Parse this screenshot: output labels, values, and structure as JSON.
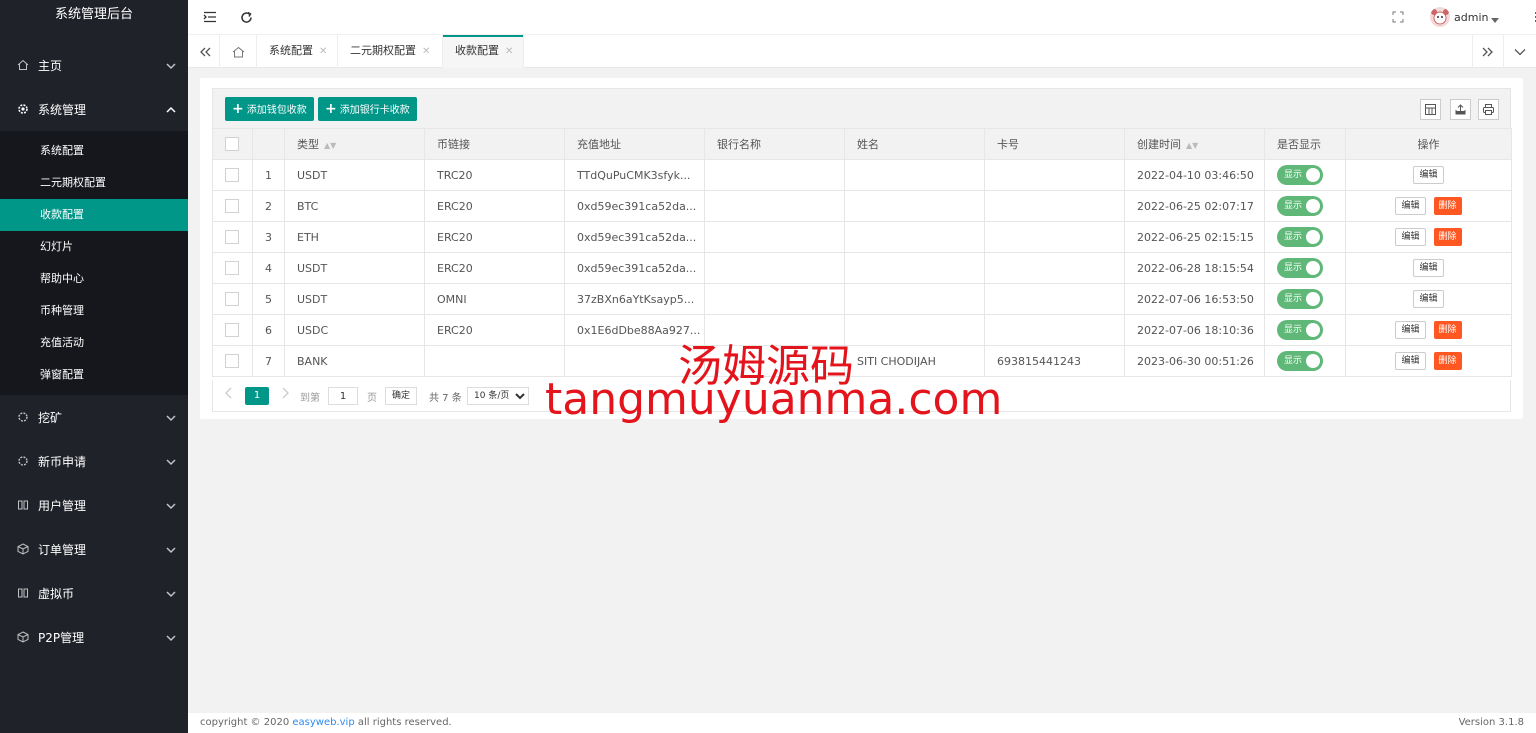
{
  "app": {
    "title": "系统管理后台"
  },
  "sidebar": {
    "home": {
      "label": "主页"
    },
    "system": {
      "label": "系统管理"
    },
    "sub_items": [
      "系统配置",
      "二元期权配置",
      "收款配置",
      "幻灯片",
      "帮助中心",
      "币种管理",
      "充值活动",
      "弹窗配置"
    ],
    "active_sub": "收款配置",
    "groups": [
      "挖矿",
      "新币申请",
      "用户管理",
      "订单管理",
      "虚拟币",
      "P2P管理"
    ]
  },
  "header": {
    "user": "admin"
  },
  "tabs": [
    {
      "label": "系统配置"
    },
    {
      "label": "二元期权配置"
    },
    {
      "label": "收款配置",
      "active": true
    }
  ],
  "toolbar": {
    "add_wallet": "添加钱包收款",
    "add_bank": "添加银行卡收款"
  },
  "table": {
    "headers": [
      "",
      "",
      "类型",
      "币链接",
      "充值地址",
      "银行名称",
      "姓名",
      "卡号",
      "创建时间",
      "是否显示",
      "操作"
    ],
    "rows": [
      {
        "no": "1",
        "type": "USDT",
        "chain": "TRC20",
        "address": "TTdQuPuCMK3sfyk...",
        "bank": "",
        "name": "",
        "card": "",
        "created": "2022-04-10 03:46:50",
        "show": "显示",
        "deletable": false
      },
      {
        "no": "2",
        "type": "BTC",
        "chain": "ERC20",
        "address": "0xd59ec391ca52da...",
        "bank": "",
        "name": "",
        "card": "",
        "created": "2022-06-25 02:07:17",
        "show": "显示",
        "deletable": true
      },
      {
        "no": "3",
        "type": "ETH",
        "chain": "ERC20",
        "address": "0xd59ec391ca52da...",
        "bank": "",
        "name": "",
        "card": "",
        "created": "2022-06-25 02:15:15",
        "show": "显示",
        "deletable": true
      },
      {
        "no": "4",
        "type": "USDT",
        "chain": "ERC20",
        "address": "0xd59ec391ca52da...",
        "bank": "",
        "name": "",
        "card": "",
        "created": "2022-06-28 18:15:54",
        "show": "显示",
        "deletable": false
      },
      {
        "no": "5",
        "type": "USDT",
        "chain": "OMNI",
        "address": "37zBXn6aYtKsayp5...",
        "bank": "",
        "name": "",
        "card": "",
        "created": "2022-07-06 16:53:50",
        "show": "显示",
        "deletable": false
      },
      {
        "no": "6",
        "type": "USDC",
        "chain": "ERC20",
        "address": "0x1E6dDbe88Aa927...",
        "bank": "",
        "name": "",
        "card": "",
        "created": "2022-07-06 18:10:36",
        "show": "显示",
        "deletable": true
      },
      {
        "no": "7",
        "type": "BANK",
        "chain": "",
        "address": "",
        "bank": "",
        "name": "SITI CHODIJAH",
        "card": "693815441243",
        "created": "2023-06-30 00:51:26",
        "show": "显示",
        "deletable": true
      }
    ],
    "edit_label": "编辑",
    "delete_label": "删除"
  },
  "pager": {
    "current": "1",
    "goto": "到第",
    "page_value": "1",
    "page_unit": "页",
    "confirm": "确定",
    "total": "共 7 条",
    "per_page": "10 条/页"
  },
  "footer": {
    "copyright": "copyright © 2020 ",
    "link": "easyweb.vip",
    "rights": " all rights reserved.",
    "version": "Version 3.1.8"
  },
  "watermark": {
    "cn": "汤姆源码",
    "en": "tangmuyuanma.com"
  },
  "colors": {
    "accent": "#009688",
    "switch": "#5fb878",
    "danger": "#ff5722",
    "sidebar": "#20222a",
    "watermark": "#e4141c"
  }
}
